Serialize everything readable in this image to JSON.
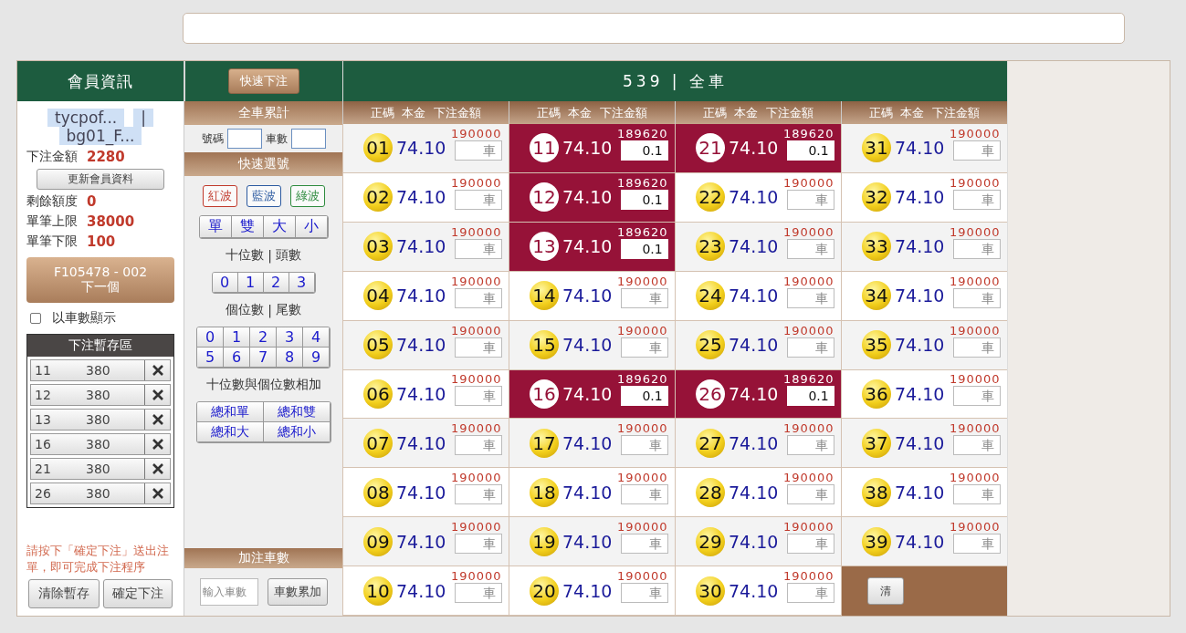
{
  "header": {
    "member_title": "會員資訊",
    "quick_bet_button": "快速下注",
    "game_title": "539 | 全車"
  },
  "member": {
    "account": "tycpof...",
    "separator": "|",
    "sub_account": "bg01_F...",
    "stats": [
      {
        "label": "下注金額",
        "value": "2280"
      },
      {
        "label": "剩餘額度",
        "value": "0"
      },
      {
        "label": "單筆上限",
        "value": "38000"
      },
      {
        "label": "單筆下限",
        "value": "100"
      }
    ],
    "refresh_button": "更新會員資料",
    "next_button": {
      "code": "F105478 - 002",
      "label": "下一個"
    },
    "show_by_count": {
      "label": "以車數顯示",
      "checked": false
    },
    "temp_title": "下注暫存區",
    "temp_items": [
      {
        "number": "11",
        "amount": "380"
      },
      {
        "number": "12",
        "amount": "380"
      },
      {
        "number": "13",
        "amount": "380"
      },
      {
        "number": "16",
        "amount": "380"
      },
      {
        "number": "21",
        "amount": "380"
      },
      {
        "number": "26",
        "amount": "380"
      }
    ],
    "note": "請按下「確定下注」送出注單，即可完成下注程序",
    "clear_button": "清除暫存",
    "confirm_button": "確定下注"
  },
  "quick": {
    "total_title": "全車累計",
    "number_label": "號碼",
    "count_label": "車數",
    "pick_title": "快速選號",
    "waves": [
      {
        "label": "紅波",
        "color": "#c0392b"
      },
      {
        "label": "藍波",
        "color": "#2c5aa0"
      },
      {
        "label": "綠波",
        "color": "#2e8b3e"
      }
    ],
    "parity": [
      "單",
      "雙",
      "大",
      "小"
    ],
    "tens_label": "十位數",
    "tens_sep": "|",
    "tens_alt": "頭數",
    "tens": [
      "0",
      "1",
      "2",
      "3"
    ],
    "units_label": "個位數",
    "units_sep": "|",
    "units_alt": "尾數",
    "units": [
      "0",
      "1",
      "2",
      "3",
      "4",
      "5",
      "6",
      "7",
      "8",
      "9"
    ],
    "sum_label": "十位數與個位數相加",
    "sums": [
      "總和單",
      "總和雙",
      "總和大",
      "總和小"
    ],
    "add_title": "加注車數",
    "add_placeholder": "輸入車數",
    "add_button": "車數累加"
  },
  "grid": {
    "columns": [
      "正碼  本金  下注金額",
      "正碼  本金  下注金額",
      "正碼  本金  下注金額",
      "正碼  本金  下注金額"
    ],
    "cells": [
      {
        "number": "01",
        "odds": "74.10",
        "limit": "190000",
        "selected": false,
        "placeholder": "車"
      },
      {
        "number": "02",
        "odds": "74.10",
        "limit": "190000",
        "selected": false,
        "placeholder": "車"
      },
      {
        "number": "03",
        "odds": "74.10",
        "limit": "190000",
        "selected": false,
        "placeholder": "車"
      },
      {
        "number": "04",
        "odds": "74.10",
        "limit": "190000",
        "selected": false,
        "placeholder": "車"
      },
      {
        "number": "05",
        "odds": "74.10",
        "limit": "190000",
        "selected": false,
        "placeholder": "車"
      },
      {
        "number": "06",
        "odds": "74.10",
        "limit": "190000",
        "selected": false,
        "placeholder": "車"
      },
      {
        "number": "07",
        "odds": "74.10",
        "limit": "190000",
        "selected": false,
        "placeholder": "車"
      },
      {
        "number": "08",
        "odds": "74.10",
        "limit": "190000",
        "selected": false,
        "placeholder": "車"
      },
      {
        "number": "09",
        "odds": "74.10",
        "limit": "190000",
        "selected": false,
        "placeholder": "車"
      },
      {
        "number": "10",
        "odds": "74.10",
        "limit": "190000",
        "selected": false,
        "placeholder": "車"
      },
      {
        "number": "11",
        "odds": "74.10",
        "limit": "189620",
        "selected": true,
        "value": "0.1"
      },
      {
        "number": "12",
        "odds": "74.10",
        "limit": "189620",
        "selected": true,
        "value": "0.1"
      },
      {
        "number": "13",
        "odds": "74.10",
        "limit": "189620",
        "selected": true,
        "value": "0.1"
      },
      {
        "number": "14",
        "odds": "74.10",
        "limit": "190000",
        "selected": false,
        "placeholder": "車"
      },
      {
        "number": "15",
        "odds": "74.10",
        "limit": "190000",
        "selected": false,
        "placeholder": "車"
      },
      {
        "number": "16",
        "odds": "74.10",
        "limit": "189620",
        "selected": true,
        "value": "0.1"
      },
      {
        "number": "17",
        "odds": "74.10",
        "limit": "190000",
        "selected": false,
        "placeholder": "車"
      },
      {
        "number": "18",
        "odds": "74.10",
        "limit": "190000",
        "selected": false,
        "placeholder": "車"
      },
      {
        "number": "19",
        "odds": "74.10",
        "limit": "190000",
        "selected": false,
        "placeholder": "車"
      },
      {
        "number": "20",
        "odds": "74.10",
        "limit": "190000",
        "selected": false,
        "placeholder": "車"
      },
      {
        "number": "21",
        "odds": "74.10",
        "limit": "189620",
        "selected": true,
        "value": "0.1"
      },
      {
        "number": "22",
        "odds": "74.10",
        "limit": "190000",
        "selected": false,
        "placeholder": "車"
      },
      {
        "number": "23",
        "odds": "74.10",
        "limit": "190000",
        "selected": false,
        "placeholder": "車"
      },
      {
        "number": "24",
        "odds": "74.10",
        "limit": "190000",
        "selected": false,
        "placeholder": "車"
      },
      {
        "number": "25",
        "odds": "74.10",
        "limit": "190000",
        "selected": false,
        "placeholder": "車"
      },
      {
        "number": "26",
        "odds": "74.10",
        "limit": "189620",
        "selected": true,
        "value": "0.1"
      },
      {
        "number": "27",
        "odds": "74.10",
        "limit": "190000",
        "selected": false,
        "placeholder": "車"
      },
      {
        "number": "28",
        "odds": "74.10",
        "limit": "190000",
        "selected": false,
        "placeholder": "車"
      },
      {
        "number": "29",
        "odds": "74.10",
        "limit": "190000",
        "selected": false,
        "placeholder": "車"
      },
      {
        "number": "30",
        "odds": "74.10",
        "limit": "190000",
        "selected": false,
        "placeholder": "車"
      },
      {
        "number": "31",
        "odds": "74.10",
        "limit": "190000",
        "selected": false,
        "placeholder": "車"
      },
      {
        "number": "32",
        "odds": "74.10",
        "limit": "190000",
        "selected": false,
        "placeholder": "車"
      },
      {
        "number": "33",
        "odds": "74.10",
        "limit": "190000",
        "selected": false,
        "placeholder": "車"
      },
      {
        "number": "34",
        "odds": "74.10",
        "limit": "190000",
        "selected": false,
        "placeholder": "車"
      },
      {
        "number": "35",
        "odds": "74.10",
        "limit": "190000",
        "selected": false,
        "placeholder": "車"
      },
      {
        "number": "36",
        "odds": "74.10",
        "limit": "190000",
        "selected": false,
        "placeholder": "車"
      },
      {
        "number": "37",
        "odds": "74.10",
        "limit": "190000",
        "selected": false,
        "placeholder": "車"
      },
      {
        "number": "38",
        "odds": "74.10",
        "limit": "190000",
        "selected": false,
        "placeholder": "車"
      },
      {
        "number": "39",
        "odds": "74.10",
        "limit": "190000",
        "selected": false,
        "placeholder": "車"
      }
    ],
    "action_button": "清"
  }
}
